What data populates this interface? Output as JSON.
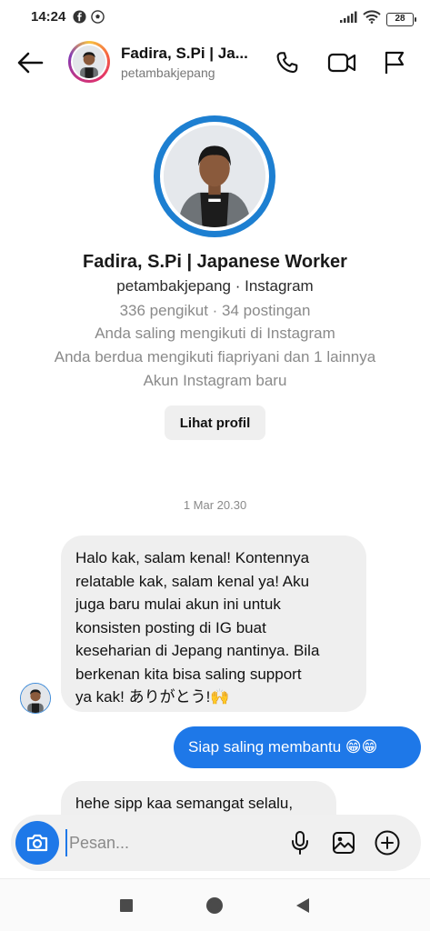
{
  "status_bar": {
    "time": "14:24",
    "battery": "28",
    "icons": [
      "facebook-icon",
      "soccer-ball-icon",
      "signal-icon",
      "wifi-icon",
      "battery-icon"
    ]
  },
  "header": {
    "name": "Fadira, S.Pi | Ja...",
    "username": "petambakjepang",
    "icons": [
      "back-arrow-icon",
      "phone-icon",
      "video-camera-icon",
      "flag-icon"
    ]
  },
  "profile": {
    "name": "Fadira, S.Pi | Japanese Worker",
    "handle": "petambakjepang · Instagram",
    "stats": "336 pengikut · 34 postingan",
    "follow_status": "Anda saling mengikuti di Instagram",
    "mutuals": "Anda berdua mengikuti fiapriyani dan 1 lainnya",
    "account_note": "Akun Instagram baru",
    "view_profile_label": "Lihat profil"
  },
  "conversation": {
    "timestamp": "1 Mar 20.30",
    "messages": [
      {
        "direction": "incoming",
        "lines": [
          "Halo kak, salam kenal! Kontennya",
          "relatable kak, salam kenal ya! Aku",
          "juga baru mulai akun ini untuk",
          "konsisten posting di IG buat",
          "keseharian di Jepang nantinya. Bila",
          "berkenan kita bisa saling support",
          "ya kak! ありがとう!🙌"
        ]
      },
      {
        "direction": "outgoing",
        "text": "Siap saling membantu 😁😁"
      },
      {
        "direction": "incoming",
        "text": "hehe sipp kaa semangat selalu,"
      }
    ]
  },
  "composer": {
    "placeholder": "Pesan...",
    "value": ""
  },
  "colors": {
    "accent": "#1e78e8",
    "bubble_in": "#efefef",
    "muted_text": "#8a8a8a"
  }
}
